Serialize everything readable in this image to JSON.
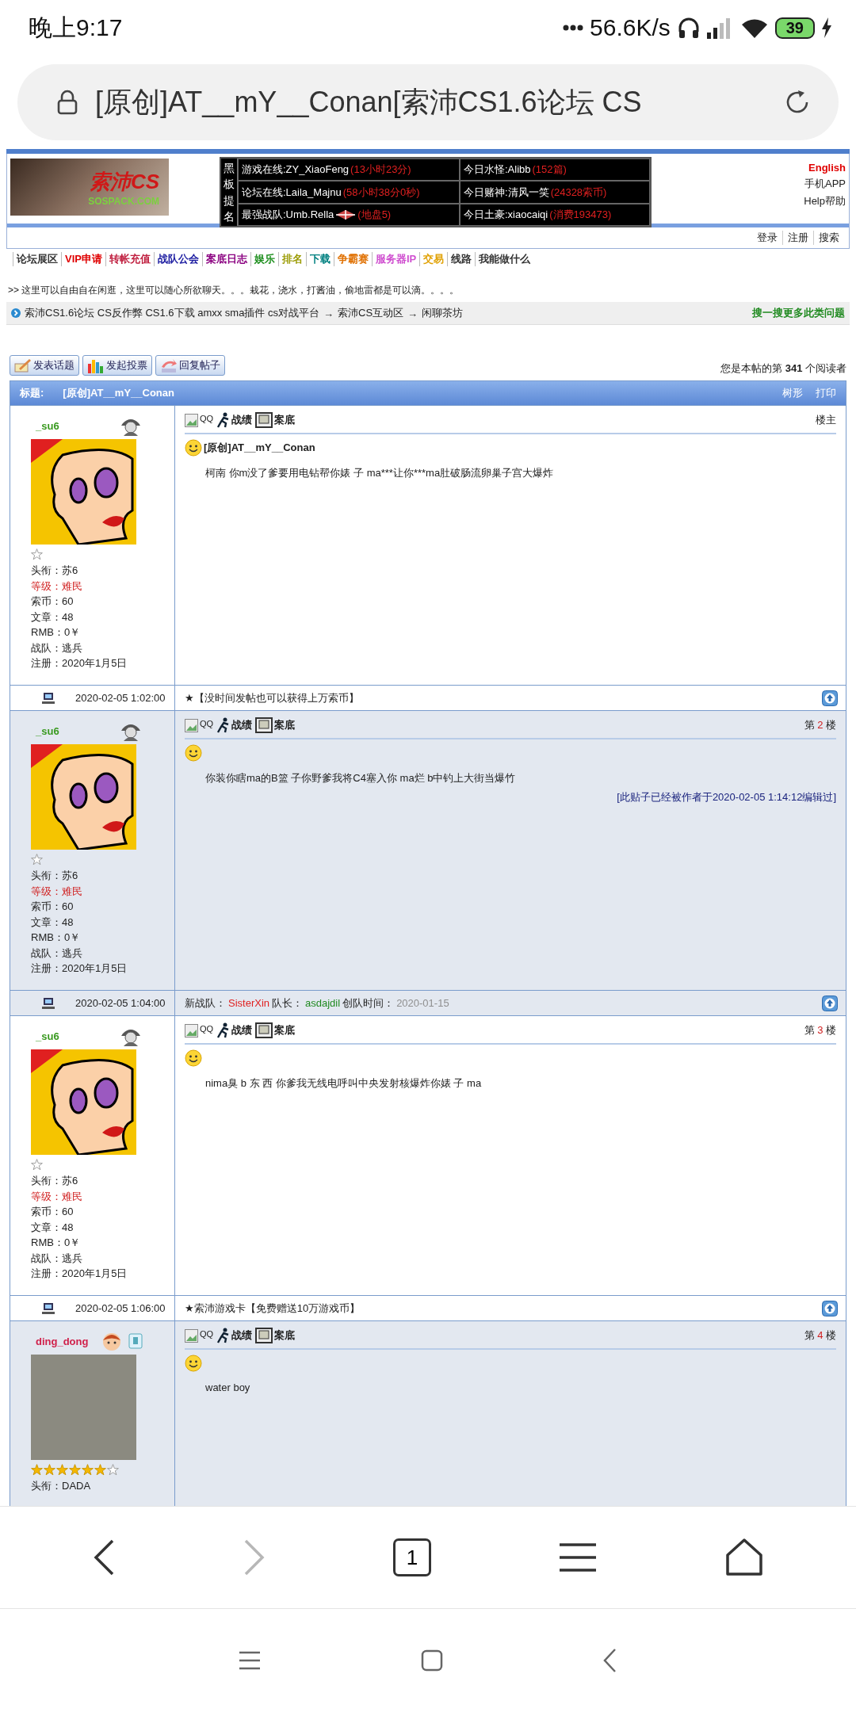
{
  "status_bar": {
    "time": "晚上9:17",
    "speed": "56.6K/s",
    "battery": "39"
  },
  "browser": {
    "url": "[原创]AT__mY__Conan[索沛CS1.6论坛 CS",
    "tab_count": "1",
    "forward_disabled": true
  },
  "header": {
    "logo": {
      "title": "索沛CS",
      "subtitle": "SOSPACK.COM"
    },
    "board_label": "黑板提名",
    "board": [
      {
        "label": "游戏在线:ZY_XiaoFeng",
        "value": "(13小时23分)",
        "kind": "plain"
      },
      {
        "label": "今日水怪:Alibb",
        "value": "(152篇)",
        "kind": "plain"
      },
      {
        "label": "论坛在线:Laila_Majnu",
        "value": "(58小时38分0秒)",
        "kind": "plain"
      },
      {
        "label": "今日赌神:清风一笑",
        "value": "(24328索币)",
        "kind": "plain"
      },
      {
        "label": "最强战队:Umb.Rella",
        "value": "(地盘5)",
        "kind": "team"
      },
      {
        "label": "今日土豪:xiaocaiqi",
        "value": "(消费193473)",
        "kind": "plain"
      }
    ],
    "side_links": [
      {
        "label": "English",
        "kind": "strong"
      },
      {
        "label": "手机APP",
        "kind": "plain"
      },
      {
        "label": "Help帮助",
        "kind": "plain"
      }
    ],
    "user_links": [
      "登录",
      "注册",
      "搜索"
    ]
  },
  "nav": [
    {
      "label": "论坛展区",
      "color": "#333333"
    },
    {
      "label": "VIP申请",
      "color": "#e00000"
    },
    {
      "label": "转帐充值",
      "color": "#c02040"
    },
    {
      "label": "战队公会",
      "color": "#1a1aa0"
    },
    {
      "label": "案底日志",
      "color": "#8b0080"
    },
    {
      "label": "娱乐",
      "color": "#209020"
    },
    {
      "label": "排名",
      "color": "#9a9a00"
    },
    {
      "label": "下载",
      "color": "#008080"
    },
    {
      "label": "争霸赛",
      "color": "#e07000"
    },
    {
      "label": "服务器IP",
      "color": "#d050d0"
    },
    {
      "label": "交易",
      "color": "#e0a000"
    },
    {
      "label": "线路",
      "color": "#333333"
    },
    {
      "label": "我能做什么",
      "color": "#333333"
    }
  ],
  "notice": ">> 这里可以自由自在闲逛，这里可以随心所欲聊天。。。栽花，浇水，打酱油，偷地雷都是可以滴。。。。",
  "breadcrumb": {
    "items": [
      "索沛CS1.6论坛 CS反作弊 CS1.6下载 amxx sma插件 cs对战平台",
      "索沛CS互动区",
      "闲聊茶坊"
    ],
    "separator": "→",
    "search_link": "搜一搜更多此类问题"
  },
  "actions": [
    {
      "label": "发表话题",
      "kind": "post"
    },
    {
      "label": "发起投票",
      "kind": "poll"
    },
    {
      "label": "回复帖子",
      "kind": "reply"
    }
  ],
  "reader": {
    "prefix": "您是本帖的第",
    "count": "341",
    "suffix": "个阅读者"
  },
  "thread_bar": {
    "label": "标题:",
    "title": "[原创]AT__mY__Conan",
    "links": [
      "树形",
      "打印"
    ]
  },
  "posts": [
    {
      "shaded": false,
      "user": {
        "name": "_su6",
        "color": "#3a9a20",
        "badge": {
          "kind": "character"
        },
        "avatar": {
          "kind": "cartoon"
        },
        "rank_icons": [
          {
            "filled": false
          }
        ],
        "profile": [
          {
            "label": "头衔：",
            "value": "苏6",
            "highlight": false
          },
          {
            "label": "等级：",
            "value": "难民",
            "highlight": true
          },
          {
            "label": "索币：",
            "value": "60",
            "highlight": false
          },
          {
            "label": "文章：",
            "value": "48",
            "highlight": false
          },
          {
            "label": "RMB：",
            "value": "0￥",
            "highlight": false
          },
          {
            "label": "战队：",
            "value": "逃兵",
            "highlight": false
          },
          {
            "label": "注册：",
            "value": "2020年1月5日",
            "highlight": false
          }
        ]
      },
      "tools": [
        {
          "label": "QQ",
          "kind": "qq"
        },
        {
          "label": "战绩",
          "kind": "record"
        },
        {
          "label": "案底",
          "kind": "file"
        }
      ],
      "floor": {
        "kind": "owner",
        "text": "楼主"
      },
      "title": "[原创]AT__mY__Conan",
      "content": "柯南 你m没了爹要用电钻帮你婊 子 ma***让你***ma肚破肠流卵巢子宫大爆炸",
      "footer": {
        "time": "2020-02-05 1:02:00",
        "signature": [
          {
            "text": "★【没时间发帖也可以获得上万索币】"
          }
        ]
      }
    },
    {
      "shaded": true,
      "user": {
        "name": "_su6",
        "color": "#3a9a20",
        "badge": {
          "kind": "character"
        },
        "avatar": {
          "kind": "cartoon"
        },
        "rank_icons": [
          {
            "filled": false
          }
        ],
        "profile": [
          {
            "label": "头衔：",
            "value": "苏6",
            "highlight": false
          },
          {
            "label": "等级：",
            "value": "难民",
            "highlight": true
          },
          {
            "label": "索币：",
            "value": "60",
            "highlight": false
          },
          {
            "label": "文章：",
            "value": "48",
            "highlight": false
          },
          {
            "label": "RMB：",
            "value": "0￥",
            "highlight": false
          },
          {
            "label": "战队：",
            "value": "逃兵",
            "highlight": false
          },
          {
            "label": "注册：",
            "value": "2020年1月5日",
            "highlight": false
          }
        ]
      },
      "tools": [
        {
          "label": "QQ",
          "kind": "qq"
        },
        {
          "label": "战绩",
          "kind": "record"
        },
        {
          "label": "案底",
          "kind": "file"
        }
      ],
      "floor": {
        "kind": "number",
        "prefix": "第",
        "number": "2",
        "suffix": "楼"
      },
      "content": "你装你瞎ma的B篮 子你野爹我将C4塞入你 ma烂 b中钓上大街当爆竹",
      "edit_note": "[此贴子已经被作者于2020-02-05 1:14:12编辑过]",
      "footer": {
        "time": "2020-02-05 1:04:00",
        "signature": [
          {
            "text": "新战队："
          },
          {
            "text": "SisterXin",
            "color": "#e02020"
          },
          {
            "text": "队长："
          },
          {
            "text": "asdajdil",
            "color": "#208a20"
          },
          {
            "text": "创队时间："
          },
          {
            "text": "2020-01-15",
            "color": "#8f8f8f"
          }
        ]
      }
    },
    {
      "shaded": false,
      "user": {
        "name": "_su6",
        "color": "#3a9a20",
        "badge": {
          "kind": "character"
        },
        "avatar": {
          "kind": "cartoon"
        },
        "rank_icons": [
          {
            "filled": false
          }
        ],
        "profile": [
          {
            "label": "头衔：",
            "value": "苏6",
            "highlight": false
          },
          {
            "label": "等级：",
            "value": "难民",
            "highlight": true
          },
          {
            "label": "索币：",
            "value": "60",
            "highlight": false
          },
          {
            "label": "文章：",
            "value": "48",
            "highlight": false
          },
          {
            "label": "RMB：",
            "value": "0￥",
            "highlight": false
          },
          {
            "label": "战队：",
            "value": "逃兵",
            "highlight": false
          },
          {
            "label": "注册：",
            "value": "2020年1月5日",
            "highlight": false
          }
        ]
      },
      "tools": [
        {
          "label": "QQ",
          "kind": "qq"
        },
        {
          "label": "战绩",
          "kind": "record"
        },
        {
          "label": "案底",
          "kind": "file"
        }
      ],
      "floor": {
        "kind": "number",
        "prefix": "第",
        "number": "3",
        "suffix": "楼"
      },
      "content": "nima臭 b 东 西 你爹我无线电呼叫中央发射核爆炸你婊  子 ma",
      "footer": {
        "time": "2020-02-05 1:06:00",
        "signature": [
          {
            "text": "★索沛游戏卡【免费赠送10万游戏币】"
          }
        ]
      }
    },
    {
      "shaded": true,
      "user": {
        "name": "ding_dong",
        "color": "#d0204a",
        "badge": {
          "kind": "boy"
        },
        "avatar": {
          "kind": "photo"
        },
        "rank_icons": [
          {
            "filled": true
          },
          {
            "filled": true
          },
          {
            "filled": true
          },
          {
            "filled": true
          },
          {
            "filled": true
          },
          {
            "filled": true
          },
          {
            "filled": false
          }
        ],
        "profile": [
          {
            "label": "头衔：",
            "value": "DADA",
            "highlight": false
          }
        ]
      },
      "tools": [
        {
          "label": "QQ",
          "kind": "qq"
        },
        {
          "label": "战绩",
          "kind": "record"
        },
        {
          "label": "案底",
          "kind": "file"
        }
      ],
      "floor": {
        "kind": "number",
        "prefix": "第",
        "number": "4",
        "suffix": "楼"
      },
      "content": "water boy"
    }
  ]
}
